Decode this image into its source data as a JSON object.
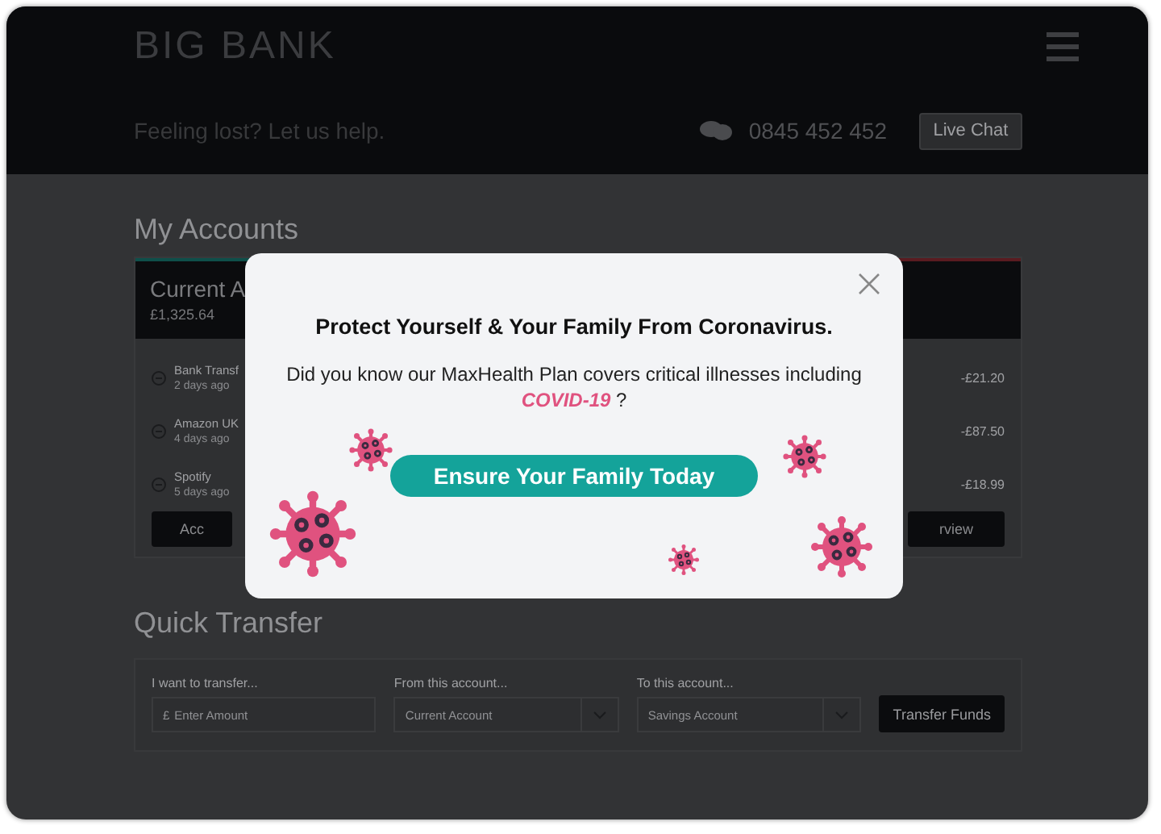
{
  "header": {
    "logo": "BIG BANK",
    "help_text": "Feeling lost? Let us help.",
    "phone": "0845 452 452",
    "live_chat_button": "Live Chat"
  },
  "accounts": {
    "title": "My Accounts",
    "cards": [
      {
        "title": "Current A",
        "balance": "£1,325.64",
        "color": "#0f4f4a",
        "transactions": [
          {
            "name": "Bank Transf",
            "time": "2 days ago"
          },
          {
            "name": "Amazon UK",
            "time": "4 days ago"
          },
          {
            "name": "Spotify",
            "time": "5 days ago"
          }
        ],
        "button": "Acc"
      },
      {
        "color": "#5a1b20",
        "transactions": [
          {
            "amount": "-£21.20"
          },
          {
            "amount": "-£87.50"
          },
          {
            "amount": "-£18.99"
          }
        ],
        "button": "rview"
      }
    ]
  },
  "quick_transfer": {
    "title": "Quick Transfer",
    "fields": [
      {
        "kind": "input",
        "label": "I want to transfer...",
        "prefix": "£",
        "placeholder": "Enter Amount"
      },
      {
        "kind": "select",
        "label": "From this account...",
        "value": "Current Account"
      },
      {
        "kind": "select",
        "label": "To this account...",
        "value": "Savings Account"
      }
    ],
    "button": "Transfer Funds"
  },
  "modal": {
    "title": "Protect Yourself & Your Family From Coronavirus.",
    "body": "Did you know our MaxHealth Plan covers critical illnesses including",
    "highlight": "COVID-19",
    "body_end": "?",
    "button": "Ensure Your Family Today"
  }
}
